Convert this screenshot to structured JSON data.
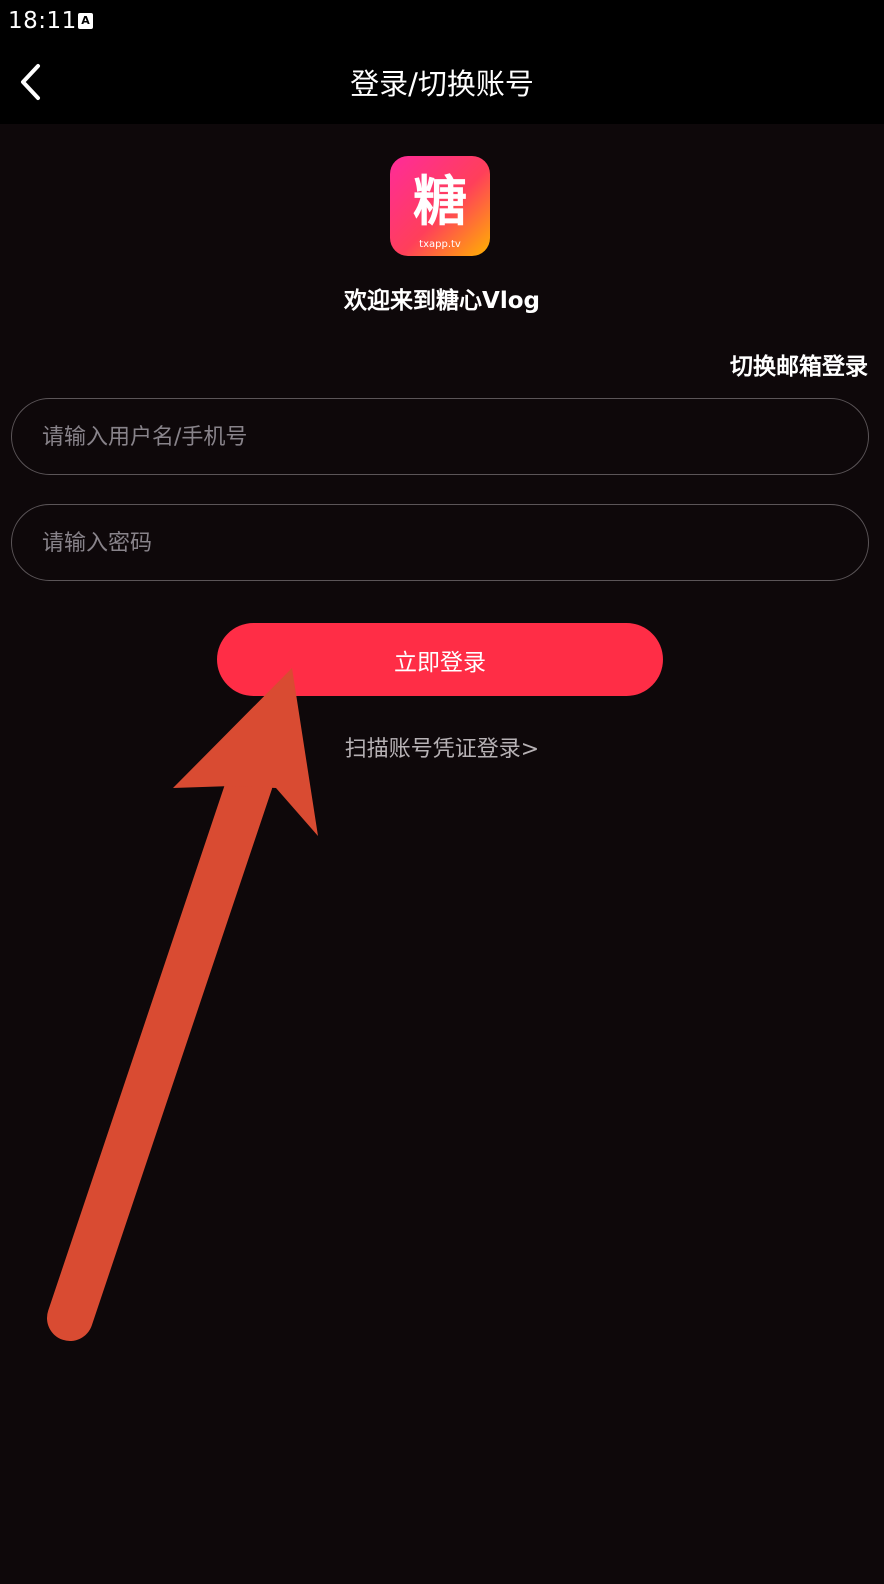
{
  "status_bar": {
    "time": "18:11",
    "notification_icon_letter": "A"
  },
  "nav": {
    "title": "登录/切换账号",
    "back_icon": "chevron-left-icon"
  },
  "logo": {
    "char": "糖",
    "sub": "txapp.tv",
    "gradient": [
      "#ff2b9a",
      "#ff5a2e",
      "#ffb300"
    ]
  },
  "welcome": "欢迎来到糖心Vlog",
  "switch_email": "切换邮箱登录",
  "form": {
    "username_placeholder": "请输入用户名/手机号",
    "password_placeholder": "请输入密码"
  },
  "login_button": "立即登录",
  "scan_link": "扫描账号凭证登录>",
  "colors": {
    "background": "#0e080a",
    "accent": "#ff2d46",
    "annotation_arrow": "#d94b32"
  }
}
